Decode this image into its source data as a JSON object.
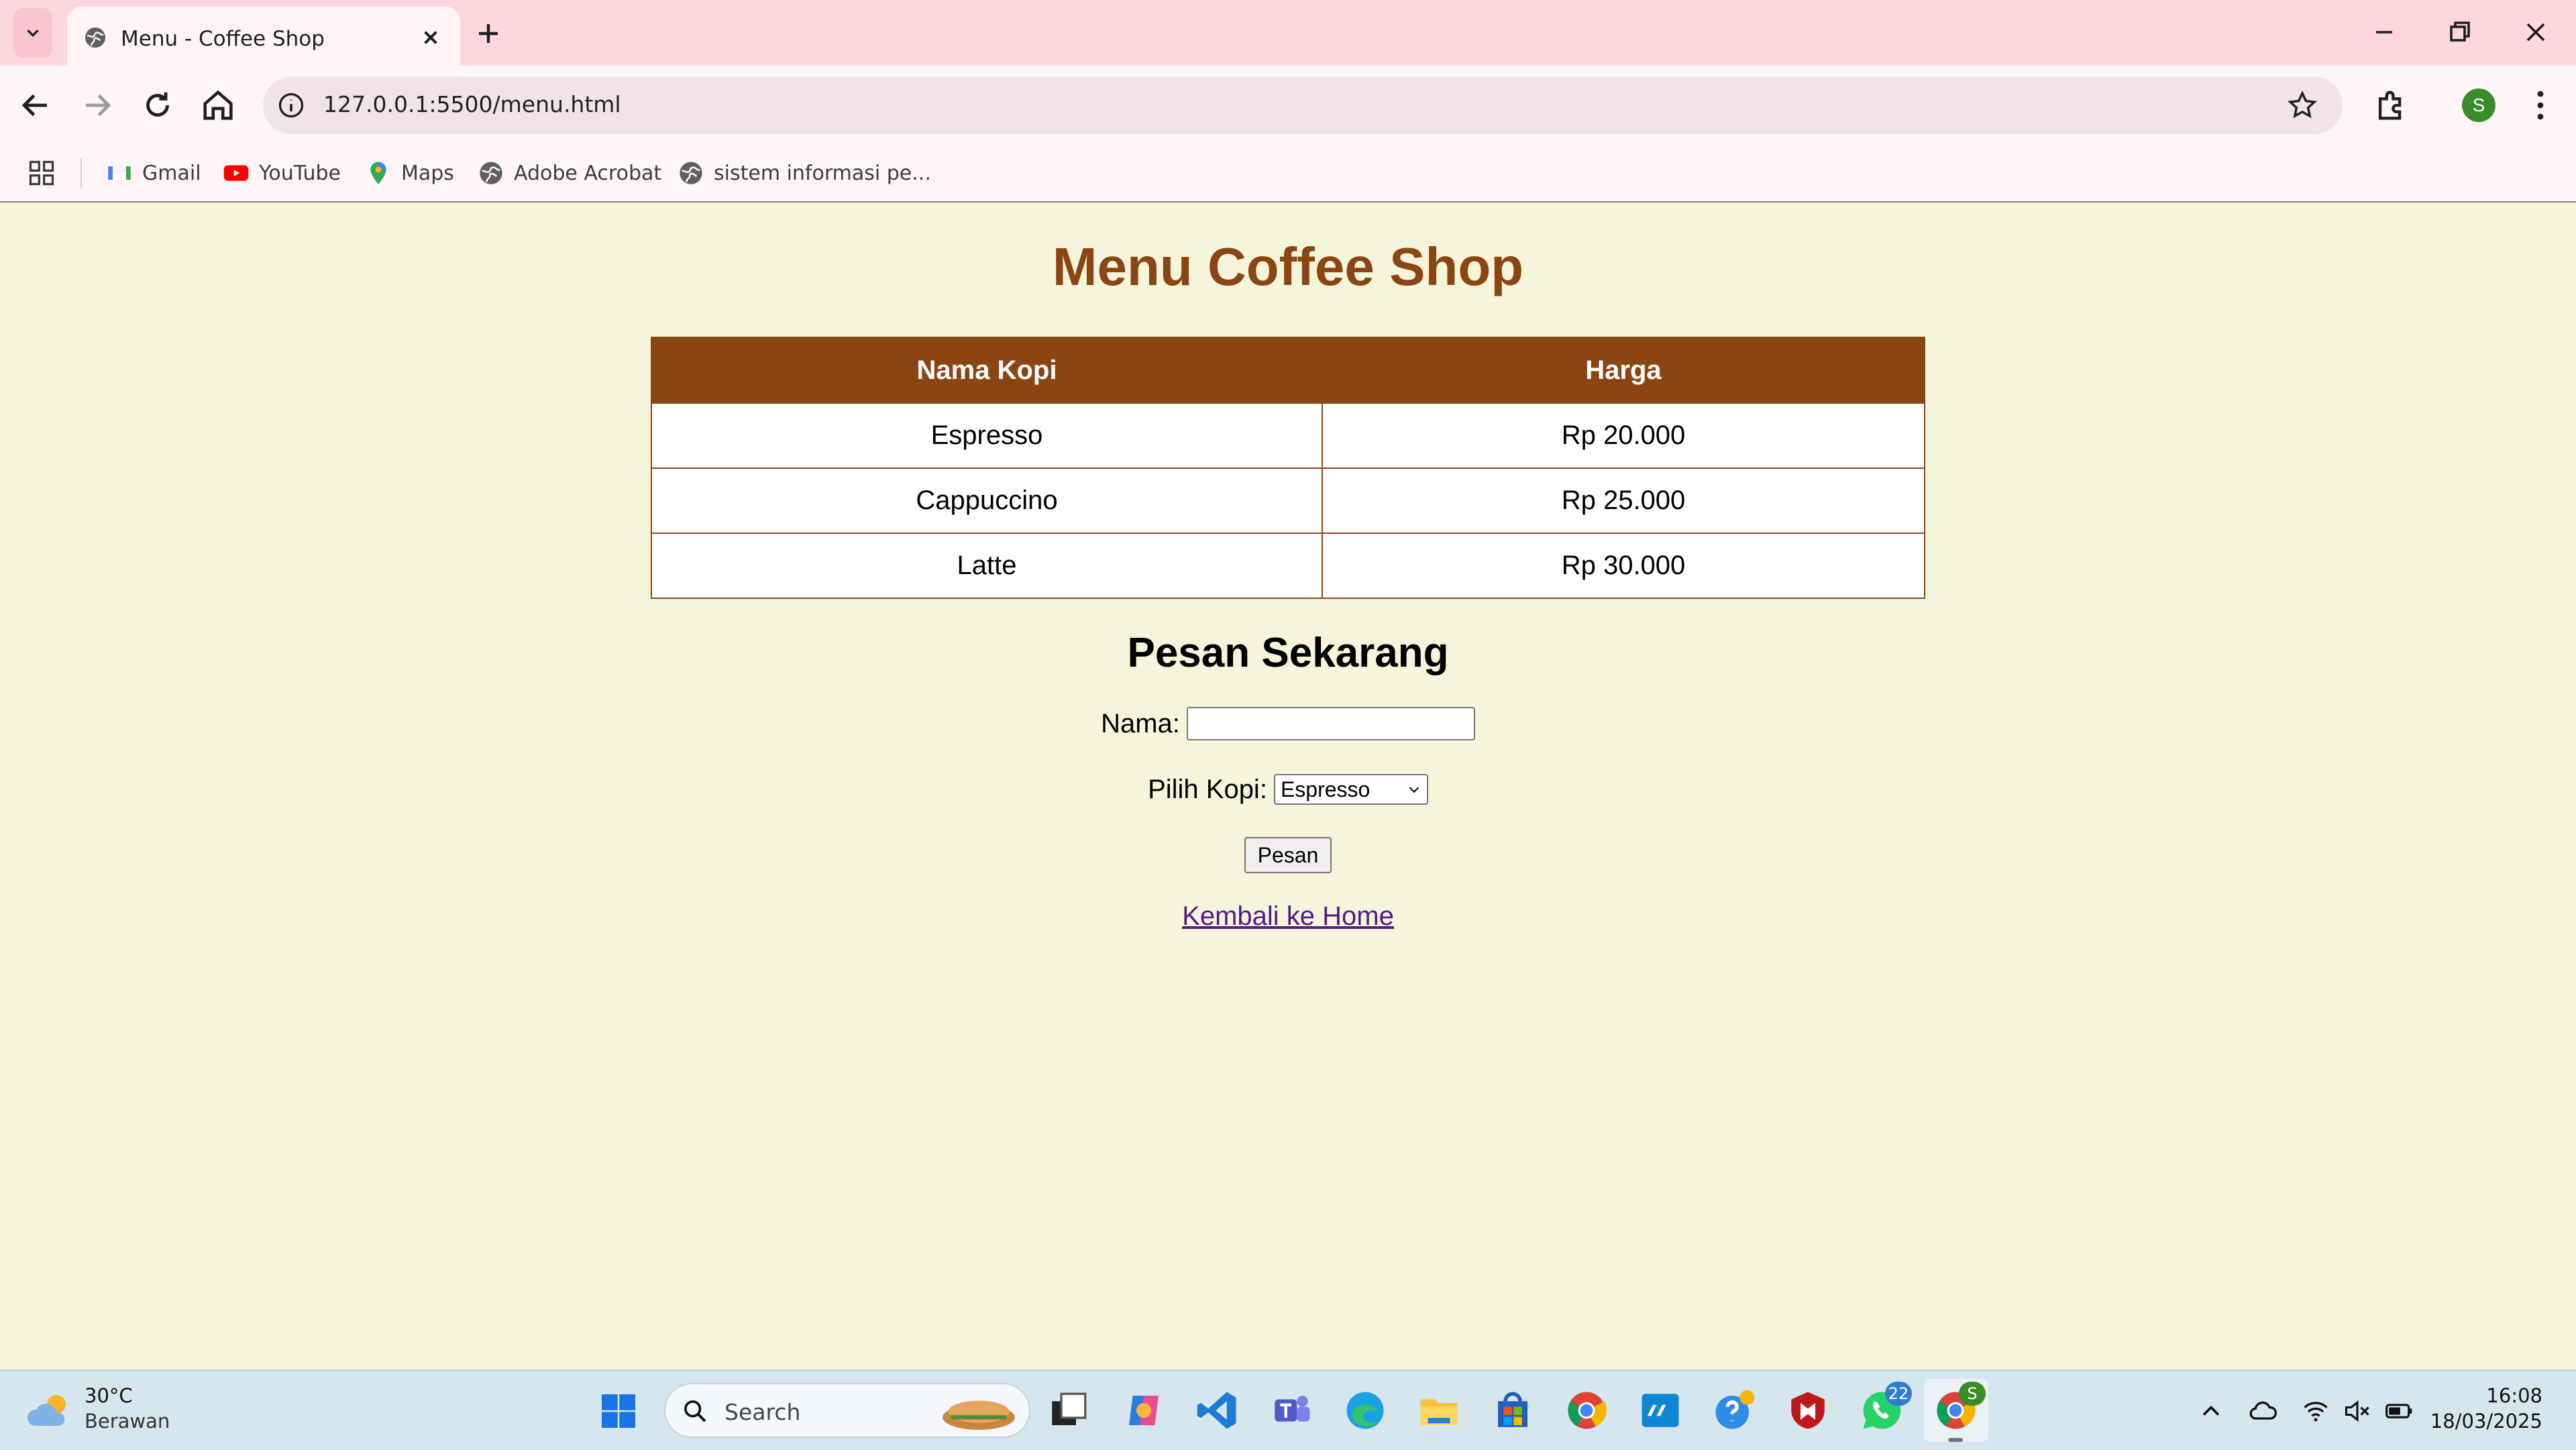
{
  "browser": {
    "tab_title": "Menu - Coffee Shop",
    "url": "127.0.0.1:5500/menu.html",
    "profile_initial": "S",
    "bookmarks": [
      {
        "label": "Gmail",
        "icon": "gmail-icon"
      },
      {
        "label": "YouTube",
        "icon": "youtube-icon"
      },
      {
        "label": "Maps",
        "icon": "maps-icon"
      },
      {
        "label": "Adobe Acrobat",
        "icon": "globe-icon"
      },
      {
        "label": "sistem informasi pe...",
        "icon": "globe-icon"
      }
    ]
  },
  "page": {
    "title": "Menu Coffee Shop",
    "table": {
      "headers": [
        "Nama Kopi",
        "Harga"
      ],
      "rows": [
        [
          "Espresso",
          "Rp 20.000"
        ],
        [
          "Cappuccino",
          "Rp 25.000"
        ],
        [
          "Latte",
          "Rp 30.000"
        ]
      ]
    },
    "order": {
      "title": "Pesan Sekarang",
      "name_label": "Nama:",
      "name_value": "",
      "coffee_label": "Pilih Kopi:",
      "coffee_selected": "Espresso",
      "submit_label": "Pesan"
    },
    "back_link": "Kembali ke Home"
  },
  "colors": {
    "page_bg": "#f5f5dc",
    "accent_brown": "#8b4513",
    "link_visited": "#551a8b"
  },
  "taskbar": {
    "weather_temp": "30°C",
    "weather_desc": "Berawan",
    "search_placeholder": "Search",
    "whatsapp_badge": "22",
    "chrome_profile_badge": "S",
    "time": "16:08",
    "date": "18/03/2025"
  }
}
